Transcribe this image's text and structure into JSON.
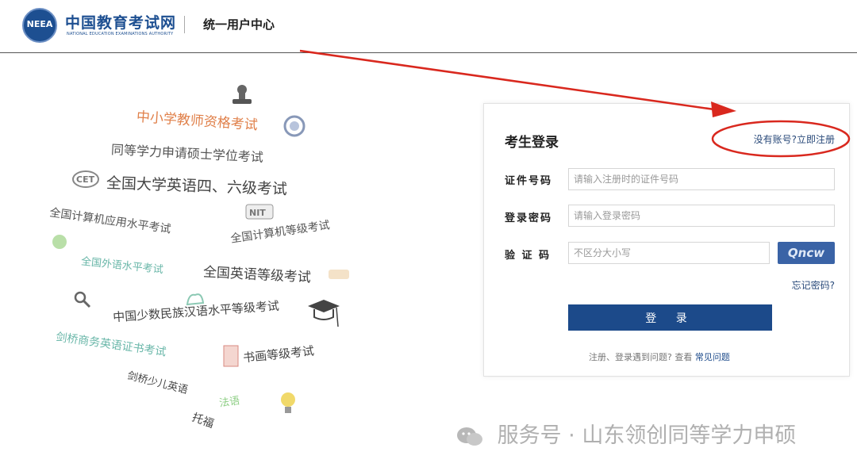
{
  "header": {
    "logo_abbr": "NEEA",
    "site_name": "中国教育考试网",
    "site_name_en": "NATIONAL EDUCATION EXAMINATIONS AUTHORITY",
    "section_title": "统一用户中心"
  },
  "illustration": {
    "exam_names": [
      "中小学教师资格考试",
      "同等学力申请硕士学位考试",
      "全国大学英语四、六级考试",
      "全国计算机应用水平考试",
      "全国计算机等级考试",
      "全国外语水平考试",
      "全国英语等级考试",
      "中国少数民族汉语水平等级考试",
      "剑桥商务英语证书考试",
      "书画等级考试",
      "剑桥少儿英语",
      "法语",
      "托福",
      "CET",
      "NIT"
    ]
  },
  "login": {
    "title": "考生登录",
    "register_link": "没有账号?立即注册",
    "id_label": "证件号码",
    "id_placeholder": "请输入注册时的证件号码",
    "password_label": "登录密码",
    "password_placeholder": "请输入登录密码",
    "captcha_label": "验 证 码",
    "captcha_placeholder": "不区分大小写",
    "captcha_text": "Qncw",
    "forgot_link": "忘记密码?",
    "login_button": "登 录",
    "help_text": "注册、登录遇到问题? 查看",
    "help_link": "常见问题"
  },
  "watermark": {
    "text": "服务号 · 山东领创同等学力申硕"
  },
  "colors": {
    "brand_blue": "#1d4f91",
    "button_blue": "#1c4a8a",
    "annotation_red": "#d9281e"
  }
}
